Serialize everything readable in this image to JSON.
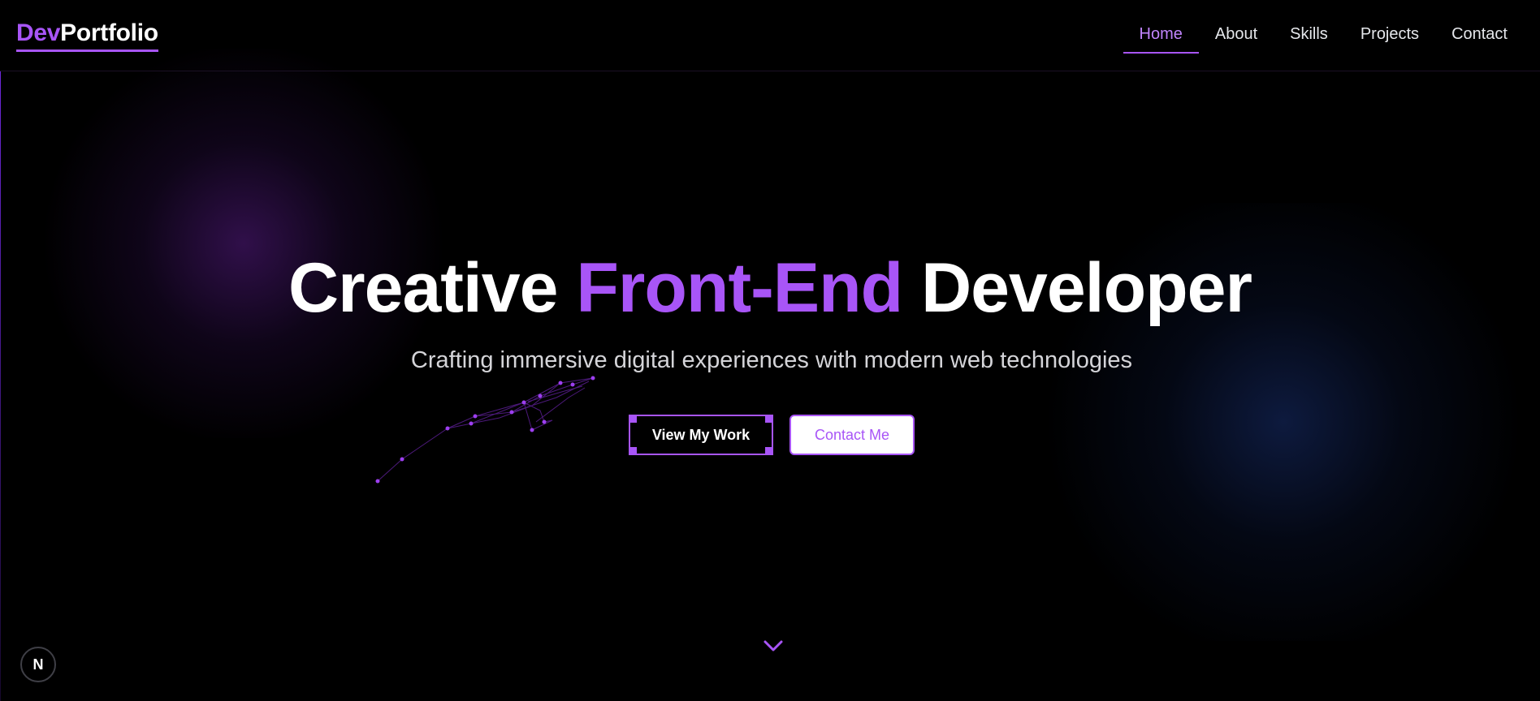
{
  "brand": {
    "logo_part1": "Dev",
    "logo_part2": "Portfolio"
  },
  "nav": {
    "items": [
      {
        "label": "Home",
        "active": true
      },
      {
        "label": "About",
        "active": false
      },
      {
        "label": "Skills",
        "active": false
      },
      {
        "label": "Projects",
        "active": false
      },
      {
        "label": "Contact",
        "active": false
      }
    ]
  },
  "hero": {
    "title_part1": "Creative",
    "title_accent": "Front-End",
    "title_part2": "Developer",
    "subtitle": "Crafting immersive digital experiences with modern web technologies",
    "primary_button": "View My Work",
    "secondary_button": "Contact Me"
  },
  "badge": {
    "label": "N"
  },
  "icons": {
    "scroll": "chevron-down-icon",
    "badge": "nextjs-badge-icon"
  },
  "colors": {
    "accent": "#a855f7",
    "background": "#000000",
    "text": "#ffffff",
    "glow_left": "#581c87",
    "glow_right": "#1e3a8a"
  }
}
